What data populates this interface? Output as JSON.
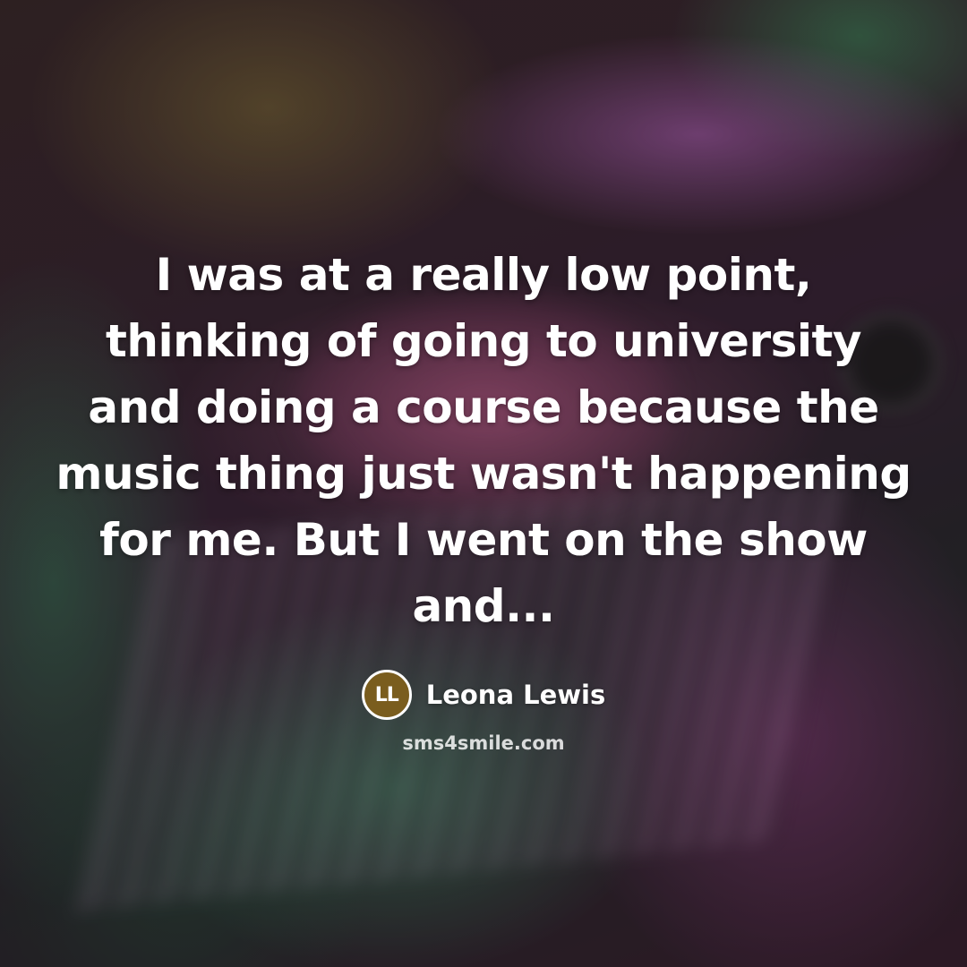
{
  "quote": {
    "text": "I was at a really low point, thinking of going to university and doing a course because the music thing just wasn't happening for me. But I went on the show and..."
  },
  "author": {
    "initials": "LL",
    "name": "Leona Lewis",
    "badge_color": "#7a5d1e"
  },
  "watermark": {
    "site": "sms4smile.com"
  }
}
